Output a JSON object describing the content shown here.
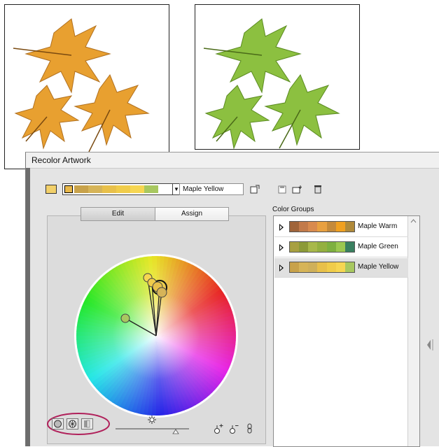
{
  "dialog": {
    "title": "Recolor Artwork",
    "current_group_name": "Maple Yellow",
    "current_swatch_color": "#f2d06a",
    "strip_colors": [
      "#c8a24a",
      "#d6b458",
      "#e8c04a",
      "#f0cc4a",
      "#f6d652",
      "#a8c860"
    ],
    "tabs": [
      {
        "label": "Edit"
      },
      {
        "label": "Assign"
      }
    ],
    "active_tab": "Edit"
  },
  "color_groups": {
    "label": "Color Groups",
    "items": [
      {
        "name": "Maple Warm",
        "colors": [
          "#a0643a",
          "#c27a4a",
          "#d88a4e",
          "#e8a040",
          "#c58a3a",
          "#f0a020",
          "#b08a3a"
        ],
        "selected": false
      },
      {
        "name": "Maple Green",
        "colors": [
          "#a8a040",
          "#8c9a38",
          "#a8b84a",
          "#94b040",
          "#7eb040",
          "#9cc850",
          "#3a8060"
        ],
        "selected": false
      },
      {
        "name": "Maple Yellow",
        "colors": [
          "#c8a24a",
          "#d6b458",
          "#cfb05a",
          "#e8c04a",
          "#f0cc4a",
          "#f6d652",
          "#a8c860"
        ],
        "selected": true
      }
    ]
  },
  "icons": [
    "new-group-icon",
    "save-icon",
    "new-folder-icon",
    "delete-icon",
    "brightness-icon",
    "add-color-icon",
    "remove-color-icon",
    "link-harmony-icon",
    "smooth-wheel-icon",
    "segmented-wheel-icon",
    "color-bars-icon",
    "collapse-arrow-icon"
  ],
  "accent_colors": {
    "highlight_ellipse": "#b0205a",
    "artwork_orange": "#e8a030",
    "artwork_green": "#8cc040"
  }
}
